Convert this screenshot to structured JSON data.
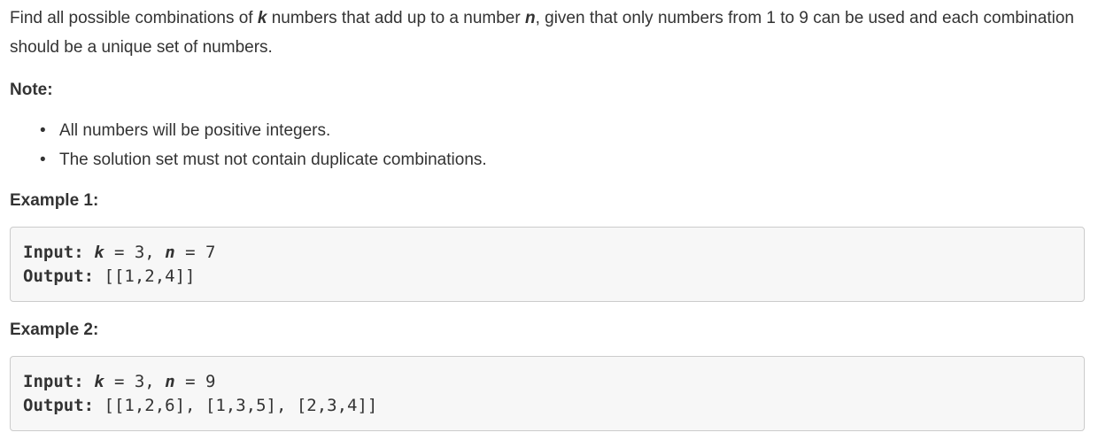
{
  "problem": {
    "description_parts": [
      "Find all possible combinations of ",
      "k",
      " numbers that add up to a number ",
      "n",
      ", given that only numbers from 1 to 9 can be used and each combination should be a unique set of numbers."
    ]
  },
  "note": {
    "heading": "Note:",
    "items": [
      "All numbers will be positive integers.",
      "The solution set must not contain duplicate combinations."
    ],
    "bullet": "•"
  },
  "examples": [
    {
      "heading": "Example 1:",
      "input_label": "Input:",
      "k_var": "k",
      "k_rest": " = 3, ",
      "n_var": "n",
      "n_rest": " = 7",
      "output_label": "Output:",
      "output_value": " [[1,2,4]]"
    },
    {
      "heading": "Example 2:",
      "input_label": "Input:",
      "k_var": "k",
      "k_rest": " = 3, ",
      "n_var": "n",
      "n_rest": " = 9",
      "output_label": "Output:",
      "output_value": " [[1,2,6], [1,3,5], [2,3,4]]"
    }
  ]
}
